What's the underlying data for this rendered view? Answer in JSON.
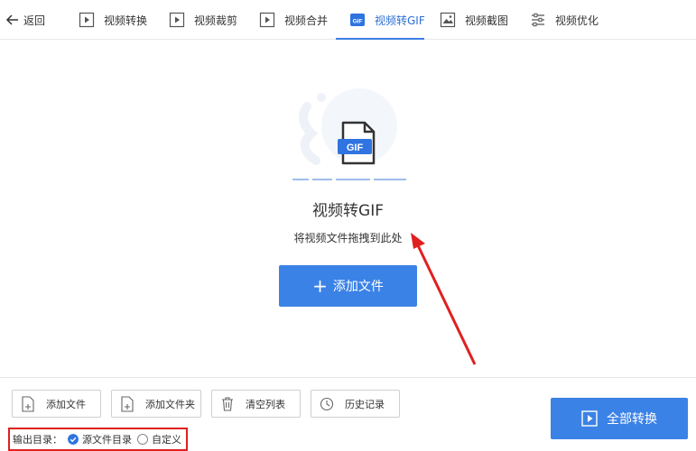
{
  "nav": {
    "back_label": "返回",
    "tabs": [
      {
        "label": "视频转换",
        "icon": "video-play-icon"
      },
      {
        "label": "视频裁剪",
        "icon": "video-crop-icon"
      },
      {
        "label": "视频合并",
        "icon": "video-merge-icon"
      },
      {
        "label": "视频转GIF",
        "icon": "gif-icon",
        "active": true
      },
      {
        "label": "视频截图",
        "icon": "screenshot-icon"
      },
      {
        "label": "视频优化",
        "icon": "sliders-icon"
      }
    ]
  },
  "main": {
    "illustration_badge": "GIF",
    "title": "视频转GIF",
    "hint": "将视频文件拖拽到此处",
    "add_button_label": "添加文件"
  },
  "toolbar": {
    "add_file": "添加文件",
    "add_folder": "添加文件夹",
    "clear_list": "清空列表",
    "history": "历史记录"
  },
  "output": {
    "label": "输出目录：",
    "options": [
      {
        "label": "源文件目录",
        "selected": true
      },
      {
        "label": "自定义",
        "selected": false
      }
    ]
  },
  "convert_all_label": "全部转换",
  "colors": {
    "accent": "#3b82e6",
    "active_tab": "#2b6fd6",
    "highlight_box": "#e02020"
  }
}
